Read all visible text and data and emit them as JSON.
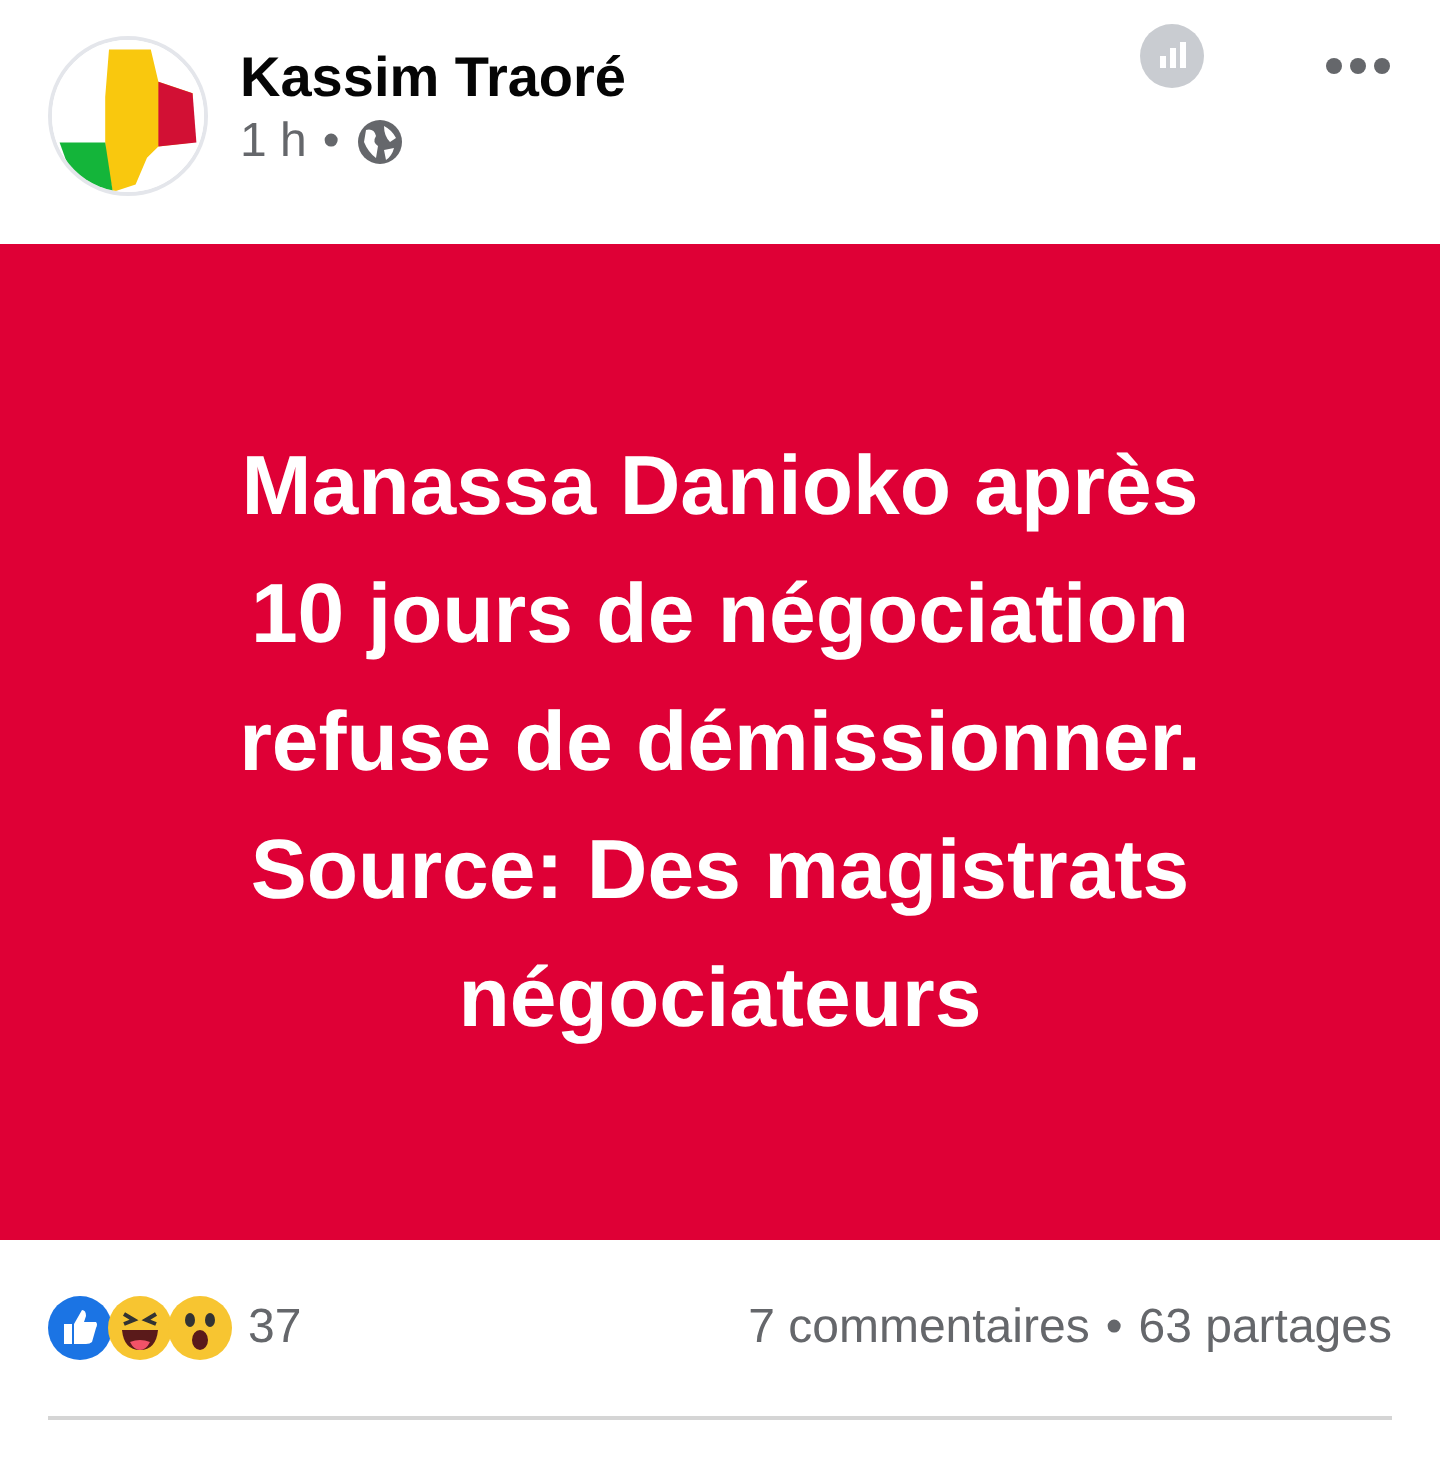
{
  "post": {
    "author": "Kassim Traoré",
    "time": "1 h",
    "separator": "•",
    "image_text": [
      "Manassa Danioko après",
      "10 jours de négociation",
      "refuse de démissionner.",
      "Source: Des magistrats",
      "négociateurs"
    ],
    "reaction_count": "37",
    "comments": "7 commentaires",
    "stats_separator": "•",
    "shares": "63 partages"
  }
}
